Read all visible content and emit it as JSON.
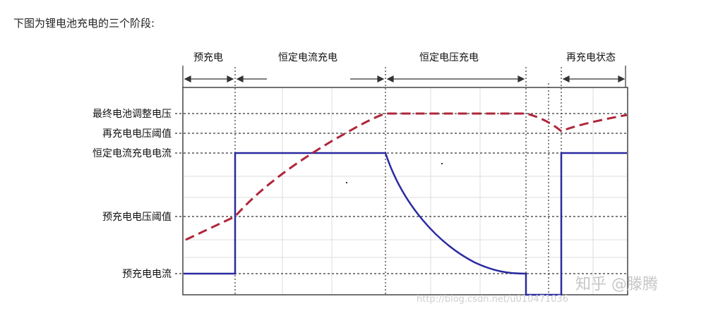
{
  "intro_text": "下图为锂电池充电的三个阶段:",
  "stages": {
    "precharge": "预充电",
    "constant_current": "恒定电流充电",
    "constant_voltage": "恒定电压充电",
    "recharge_state": "再充电状态"
  },
  "levels": {
    "final_regulation_voltage": "最终电池调整电压",
    "recharge_voltage_threshold": "再充电电压阈值",
    "constant_current_charge_current": "恒定电流充电电流",
    "precharge_voltage_threshold": "预充电电压阈值",
    "precharge_current": "预充电电流"
  },
  "watermark": {
    "zhihu": "知乎 @滕腾",
    "url": "http://blog.csdn.net/u010471036"
  },
  "colors": {
    "voltage_curve": "#b0263a",
    "current_curve": "#2a2aa0",
    "grid_line": "#dcdcdc",
    "guide_line": "#333333"
  }
}
